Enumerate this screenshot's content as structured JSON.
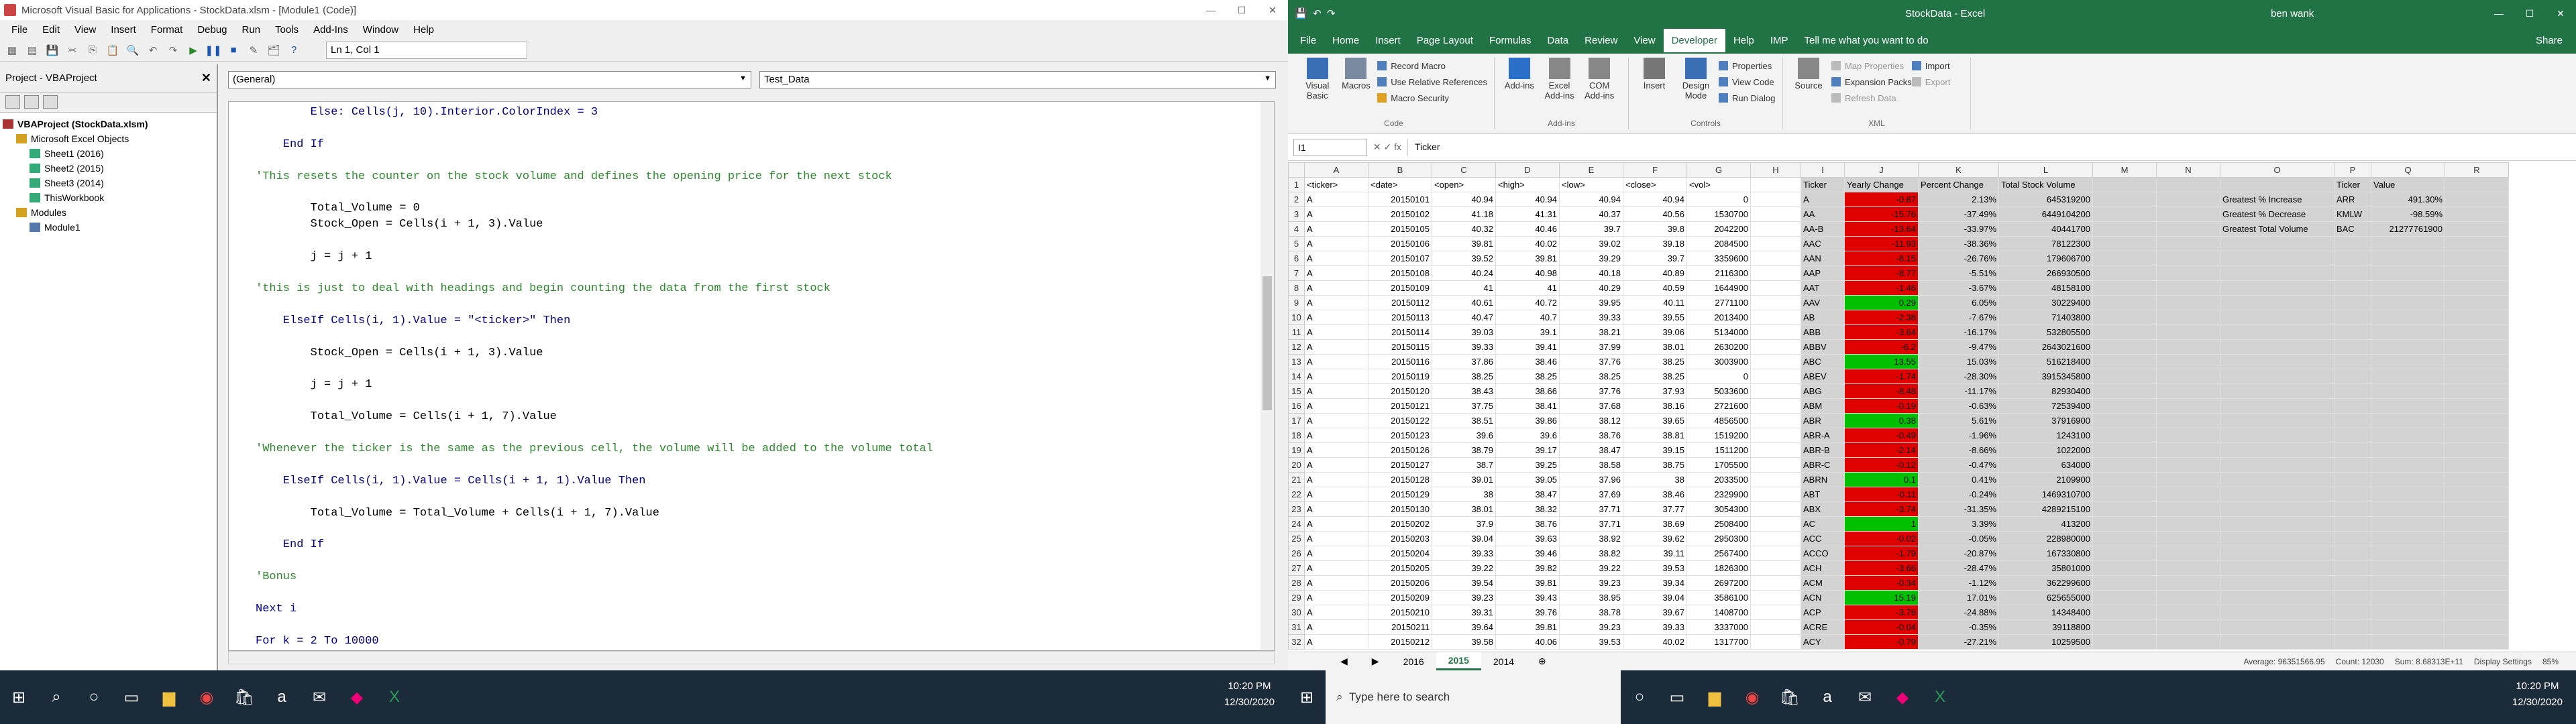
{
  "vba": {
    "title": "Microsoft Visual Basic for Applications - StockData.xlsm - [Module1 (Code)]",
    "menu": [
      "File",
      "Edit",
      "View",
      "Insert",
      "Format",
      "Debug",
      "Run",
      "Tools",
      "Add-Ins",
      "Window",
      "Help"
    ],
    "position": "Ln 1, Col 1",
    "project_title": "Project - VBAProject",
    "tree": [
      "VBAProject (StockData.xlsm)",
      "Microsoft Excel Objects",
      "Sheet1 (2016)",
      "Sheet2 (2015)",
      "Sheet3 (2014)",
      "ThisWorkbook",
      "Modules",
      "Module1"
    ],
    "combo_left": "(General)",
    "combo_right": "Test_Data",
    "code": [
      {
        "t": "        Else: Cells(j, 10).Interior.ColorIndex = 3",
        "c": "kw"
      },
      {
        "t": "",
        "c": ""
      },
      {
        "t": "    End If",
        "c": "kw"
      },
      {
        "t": "",
        "c": ""
      },
      {
        "t": "'This resets the counter on the stock volume and defines the opening price for the next stock",
        "c": "cm"
      },
      {
        "t": "",
        "c": ""
      },
      {
        "t": "        Total_Volume = 0",
        "c": ""
      },
      {
        "t": "        Stock_Open = Cells(i + 1, 3).Value",
        "c": ""
      },
      {
        "t": "",
        "c": ""
      },
      {
        "t": "        j = j + 1",
        "c": ""
      },
      {
        "t": "",
        "c": ""
      },
      {
        "t": "'this is just to deal with headings and begin counting the data from the first stock",
        "c": "cm"
      },
      {
        "t": "",
        "c": ""
      },
      {
        "t": "    ElseIf Cells(i, 1).Value = \"<ticker>\" Then",
        "c": "kw"
      },
      {
        "t": "",
        "c": ""
      },
      {
        "t": "        Stock_Open = Cells(i + 1, 3).Value",
        "c": ""
      },
      {
        "t": "",
        "c": ""
      },
      {
        "t": "        j = j + 1",
        "c": ""
      },
      {
        "t": "",
        "c": ""
      },
      {
        "t": "        Total_Volume = Cells(i + 1, 7).Value",
        "c": ""
      },
      {
        "t": "",
        "c": ""
      },
      {
        "t": "'Whenever the ticker is the same as the previous cell, the volume will be added to the volume total",
        "c": "cm"
      },
      {
        "t": "",
        "c": ""
      },
      {
        "t": "    ElseIf Cells(i, 1).Value = Cells(i + 1, 1).Value Then",
        "c": "kw"
      },
      {
        "t": "",
        "c": ""
      },
      {
        "t": "        Total_Volume = Total_Volume + Cells(i + 1, 7).Value",
        "c": ""
      },
      {
        "t": "",
        "c": ""
      },
      {
        "t": "    End If",
        "c": "kw"
      },
      {
        "t": "",
        "c": ""
      },
      {
        "t": "'Bonus",
        "c": "cm"
      },
      {
        "t": "",
        "c": ""
      },
      {
        "t": "Next i",
        "c": "kw"
      },
      {
        "t": "",
        "c": ""
      },
      {
        "t": "For k = 2 To 10000",
        "c": "kw"
      }
    ]
  },
  "excel": {
    "title": "StockData - Excel",
    "user": "ben wank",
    "tabs": [
      "File",
      "Home",
      "Insert",
      "Page Layout",
      "Formulas",
      "Data",
      "Review",
      "View",
      "Developer",
      "Help",
      "IMP",
      "Tell me what you want to do"
    ],
    "active_tab": "Developer",
    "share": "Share",
    "ribbon": {
      "code": {
        "label": "Code",
        "big": [
          "Visual Basic",
          "Macros"
        ],
        "small": [
          "Record Macro",
          "Use Relative References",
          "Macro Security"
        ]
      },
      "addins": {
        "label": "Add-ins",
        "big": [
          "Add-ins",
          "Excel Add-ins",
          "COM Add-ins"
        ]
      },
      "controls": {
        "label": "Controls",
        "big": [
          "Insert",
          "Design Mode"
        ],
        "small": [
          "Properties",
          "View Code",
          "Run Dialog"
        ]
      },
      "xml": {
        "label": "XML",
        "big": [
          "Source"
        ],
        "small": [
          "Map Properties",
          "Expansion Packs",
          "Refresh Data",
          "Import",
          "Export"
        ]
      }
    },
    "namebox": "I1",
    "formula": "Ticker",
    "columns": [
      "A",
      "B",
      "C",
      "D",
      "E",
      "F",
      "G",
      "H",
      "I",
      "J",
      "K",
      "L",
      "M",
      "N",
      "O",
      "P",
      "Q",
      "R"
    ],
    "rows": [
      [
        "<ticker>",
        "<date>",
        "<open>",
        "<high>",
        "<low>",
        "<close>",
        "<vol>",
        "",
        "Ticker",
        "Yearly Change",
        "Percent Change",
        "Total Stock Volume",
        "",
        "",
        "",
        "Ticker",
        "Value",
        ""
      ],
      [
        "A",
        "20150101",
        "40.94",
        "40.94",
        "40.94",
        "40.94",
        "0",
        "",
        "A",
        "-0.87",
        "2.13%",
        "645319200",
        "",
        "",
        "Greatest % Increase",
        "ARR",
        "491.30%",
        ""
      ],
      [
        "A",
        "20150102",
        "41.18",
        "41.31",
        "40.37",
        "40.56",
        "1530700",
        "",
        "AA",
        "-15.76",
        "-37.49%",
        "6449104200",
        "",
        "",
        "Greatest % Decrease",
        "KMLW",
        "-98.59%",
        ""
      ],
      [
        "A",
        "20150105",
        "40.32",
        "40.46",
        "39.7",
        "39.8",
        "2042200",
        "",
        "AA-B",
        "-13.64",
        "-33.97%",
        "40441700",
        "",
        "",
        "Greatest Total Volume",
        "BAC",
        "21277761900",
        ""
      ],
      [
        "A",
        "20150106",
        "39.81",
        "40.02",
        "39.02",
        "39.18",
        "2084500",
        "",
        "AAC",
        "-11.93",
        "-38.36%",
        "78122300",
        "",
        "",
        "",
        "",
        "",
        ""
      ],
      [
        "A",
        "20150107",
        "39.52",
        "39.81",
        "39.29",
        "39.7",
        "3359600",
        "",
        "AAN",
        "-8.15",
        "-26.76%",
        "179606700",
        "",
        "",
        "",
        "",
        "",
        ""
      ],
      [
        "A",
        "20150108",
        "40.24",
        "40.98",
        "40.18",
        "40.89",
        "2116300",
        "",
        "AAP",
        "-8.77",
        "-5.51%",
        "266930500",
        "",
        "",
        "",
        "",
        "",
        ""
      ],
      [
        "A",
        "20150109",
        "41",
        "41",
        "40.29",
        "40.59",
        "1644900",
        "",
        "AAT",
        "-1.46",
        "-3.67%",
        "48158100",
        "",
        "",
        "",
        "",
        "",
        ""
      ],
      [
        "A",
        "20150112",
        "40.61",
        "40.72",
        "39.95",
        "40.11",
        "2771100",
        "",
        "AAV",
        "0.29",
        "6.05%",
        "30229400",
        "",
        "",
        "",
        "",
        "",
        ""
      ],
      [
        "A",
        "20150113",
        "40.47",
        "40.7",
        "39.33",
        "39.55",
        "2013400",
        "",
        "AB",
        "-2.38",
        "-7.67%",
        "71403800",
        "",
        "",
        "",
        "",
        "",
        ""
      ],
      [
        "A",
        "20150114",
        "39.03",
        "39.1",
        "38.21",
        "39.06",
        "5134000",
        "",
        "ABB",
        "-3.64",
        "-16.17%",
        "532805500",
        "",
        "",
        "",
        "",
        "",
        ""
      ],
      [
        "A",
        "20150115",
        "39.33",
        "39.41",
        "37.99",
        "38.01",
        "2630200",
        "",
        "ABBV",
        "-6.2",
        "-9.47%",
        "2643021600",
        "",
        "",
        "",
        "",
        "",
        ""
      ],
      [
        "A",
        "20150116",
        "37.86",
        "38.46",
        "37.76",
        "38.25",
        "3003900",
        "",
        "ABC",
        "13.55",
        "15.03%",
        "516218400",
        "",
        "",
        "",
        "",
        "",
        ""
      ],
      [
        "A",
        "20150119",
        "38.25",
        "38.25",
        "38.25",
        "38.25",
        "0",
        "",
        "ABEV",
        "-1.74",
        "-28.30%",
        "3915345800",
        "",
        "",
        "",
        "",
        "",
        ""
      ],
      [
        "A",
        "20150120",
        "38.43",
        "38.66",
        "37.76",
        "37.93",
        "5033600",
        "",
        "ABG",
        "-8.48",
        "-11.17%",
        "82930400",
        "",
        "",
        "",
        "",
        "",
        ""
      ],
      [
        "A",
        "20150121",
        "37.75",
        "38.41",
        "37.68",
        "38.16",
        "2721600",
        "",
        "ABM",
        "-0.19",
        "-0.63%",
        "72539400",
        "",
        "",
        "",
        "",
        "",
        ""
      ],
      [
        "A",
        "20150122",
        "38.51",
        "39.86",
        "38.12",
        "39.65",
        "4856500",
        "",
        "ABR",
        "0.38",
        "5.61%",
        "37916900",
        "",
        "",
        "",
        "",
        "",
        ""
      ],
      [
        "A",
        "20150123",
        "39.6",
        "39.6",
        "38.76",
        "38.81",
        "1519200",
        "",
        "ABR-A",
        "-0.49",
        "-1.96%",
        "1243100",
        "",
        "",
        "",
        "",
        "",
        ""
      ],
      [
        "A",
        "20150126",
        "38.79",
        "39.17",
        "38.47",
        "39.15",
        "1511200",
        "",
        "ABR-B",
        "-2.14",
        "-8.66%",
        "1022000",
        "",
        "",
        "",
        "",
        "",
        ""
      ],
      [
        "A",
        "20150127",
        "38.7",
        "39.25",
        "38.58",
        "38.75",
        "1705500",
        "",
        "ABR-C",
        "-0.12",
        "-0.47%",
        "634000",
        "",
        "",
        "",
        "",
        "",
        ""
      ],
      [
        "A",
        "20150128",
        "39.01",
        "39.05",
        "37.96",
        "38",
        "2033500",
        "",
        "ABRN",
        "0.1",
        "0.41%",
        "2109900",
        "",
        "",
        "",
        "",
        "",
        ""
      ],
      [
        "A",
        "20150129",
        "38",
        "38.47",
        "37.69",
        "38.46",
        "2329900",
        "",
        "ABT",
        "-0.11",
        "-0.24%",
        "1469310700",
        "",
        "",
        "",
        "",
        "",
        ""
      ],
      [
        "A",
        "20150130",
        "38.01",
        "38.32",
        "37.71",
        "37.77",
        "3054300",
        "",
        "ABX",
        "-3.74",
        "-31.35%",
        "4289215100",
        "",
        "",
        "",
        "",
        "",
        ""
      ],
      [
        "A",
        "20150202",
        "37.9",
        "38.76",
        "37.71",
        "38.69",
        "2508400",
        "",
        "AC",
        "1",
        "3.39%",
        "413200",
        "",
        "",
        "",
        "",
        "",
        ""
      ],
      [
        "A",
        "20150203",
        "39.04",
        "39.63",
        "38.92",
        "39.62",
        "2950300",
        "",
        "ACC",
        "-0.02",
        "-0.05%",
        "228980000",
        "",
        "",
        "",
        "",
        "",
        ""
      ],
      [
        "A",
        "20150204",
        "39.33",
        "39.46",
        "38.82",
        "39.11",
        "2567400",
        "",
        "ACCO",
        "-1.79",
        "-20.87%",
        "167330800",
        "",
        "",
        "",
        "",
        "",
        ""
      ],
      [
        "A",
        "20150205",
        "39.22",
        "39.82",
        "39.22",
        "39.53",
        "1826300",
        "",
        "ACH",
        "-3.66",
        "-28.47%",
        "35801000",
        "",
        "",
        "",
        "",
        "",
        ""
      ],
      [
        "A",
        "20150206",
        "39.54",
        "39.81",
        "39.23",
        "39.34",
        "2697200",
        "",
        "ACM",
        "-0.34",
        "-1.12%",
        "362299600",
        "",
        "",
        "",
        "",
        "",
        ""
      ],
      [
        "A",
        "20150209",
        "39.23",
        "39.43",
        "38.95",
        "39.04",
        "3586100",
        "",
        "ACN",
        "15.19",
        "17.01%",
        "625655000",
        "",
        "",
        "",
        "",
        "",
        ""
      ],
      [
        "A",
        "20150210",
        "39.31",
        "39.76",
        "38.78",
        "39.67",
        "1408700",
        "",
        "ACP",
        "-3.76",
        "-24.88%",
        "14348400",
        "",
        "",
        "",
        "",
        "",
        ""
      ],
      [
        "A",
        "20150211",
        "39.64",
        "39.81",
        "39.23",
        "39.33",
        "3337000",
        "",
        "ACRE",
        "-0.04",
        "-0.35%",
        "39118800",
        "",
        "",
        "",
        "",
        "",
        ""
      ],
      [
        "A",
        "20150212",
        "39.58",
        "40.06",
        "39.53",
        "40.02",
        "1317700",
        "",
        "ACY",
        "-0.79",
        "-27.21%",
        "10259500",
        "",
        "",
        "",
        "",
        "",
        ""
      ]
    ],
    "sheets": [
      "2016",
      "2015",
      "2014"
    ],
    "active_sheet": "2015",
    "status": {
      "average": "Average: 96351566.95",
      "count": "Count: 12030",
      "sum": "Sum: 8.68313E+11",
      "display": "Display Settings",
      "zoom": "85%"
    }
  },
  "taskbar": {
    "search_placeholder": "Type here to search",
    "time": "10:20 PM",
    "date": "12/30/2020"
  },
  "colors": {
    "excel_green": "#217346",
    "neg": "#e00000",
    "pos": "#00c000",
    "taskbar": "#1c2b3a"
  }
}
